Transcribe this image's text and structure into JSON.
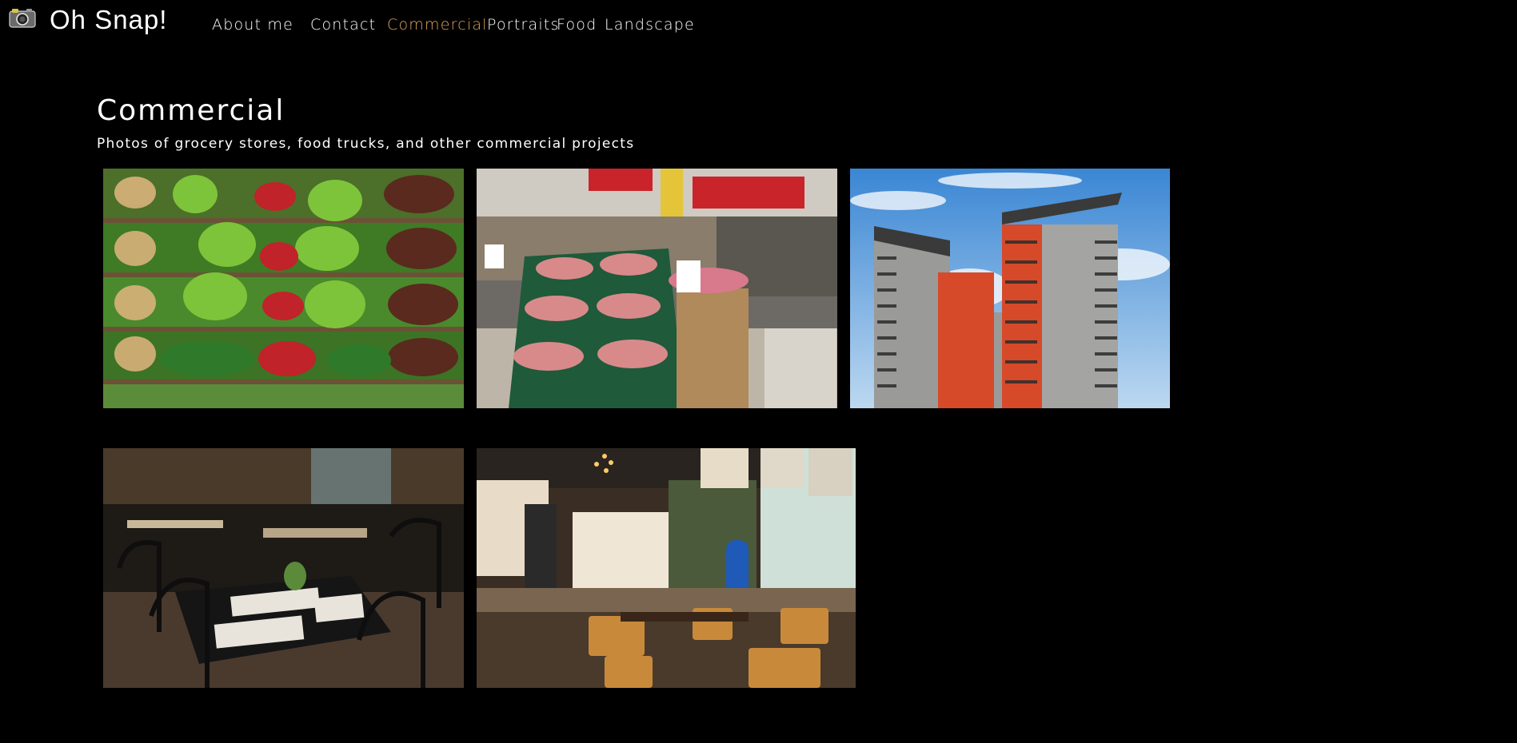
{
  "brand": {
    "logo_icon": "camera-icon",
    "name": "Oh Snap!"
  },
  "nav": {
    "items": [
      {
        "label": "About me"
      },
      {
        "label": "Contact"
      },
      {
        "label": "Commercial",
        "active": true
      },
      {
        "label": "Portraits"
      },
      {
        "label": "Food"
      },
      {
        "label": "Landscape"
      }
    ],
    "active_color": "#e0a55a"
  },
  "page": {
    "title": "Commercial",
    "subtitle": "Photos of grocery stores, food trucks, and other commercial projects"
  },
  "gallery": {
    "photos": [
      {
        "subject": "grocery-produce-shelves-photo"
      },
      {
        "subject": "supermarket-fruit-display-photo"
      },
      {
        "subject": "apartment-tower-blocks-photo"
      },
      {
        "subject": "dark-restaurant-dining-room-photo"
      },
      {
        "subject": "cafe-interior-photo"
      }
    ]
  }
}
